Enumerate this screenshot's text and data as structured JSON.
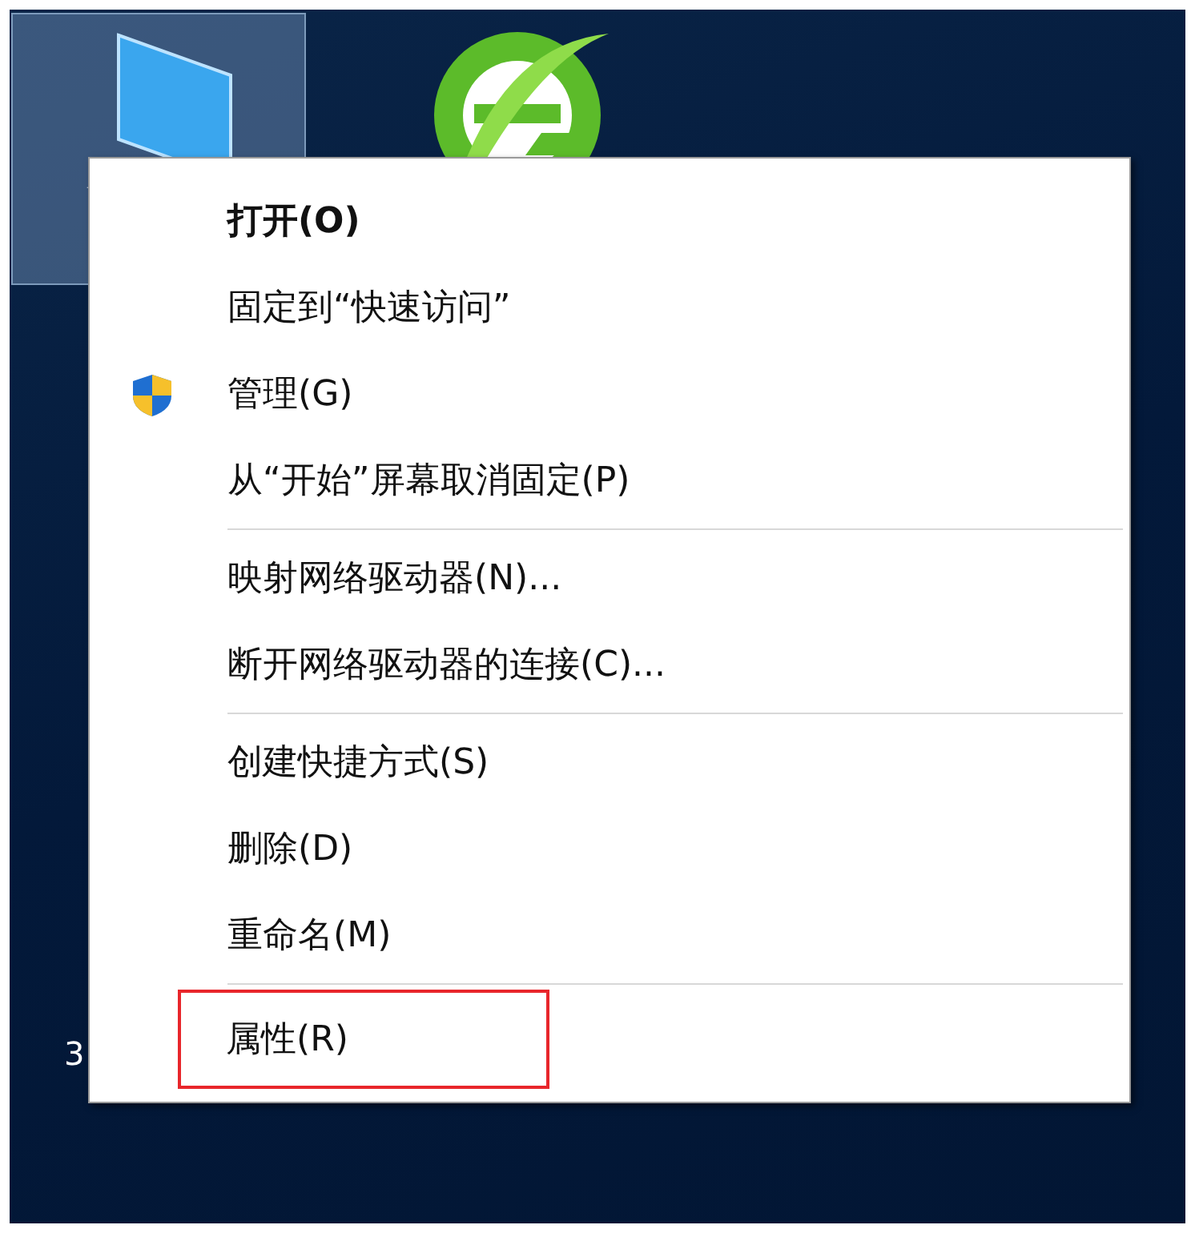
{
  "desktop": {
    "icons": [
      {
        "kind": "computer",
        "selected": true
      },
      {
        "kind": "browser",
        "selected": false
      }
    ],
    "partial_label": "3"
  },
  "context_menu": {
    "groups": [
      {
        "items": [
          {
            "label": "打开(O)",
            "default": true,
            "shield": false,
            "highlighted": false
          },
          {
            "label": "固定到“快速访问”",
            "default": false,
            "shield": false,
            "highlighted": false
          },
          {
            "label": "管理(G)",
            "default": false,
            "shield": true,
            "highlighted": false
          },
          {
            "label": "从“开始”屏幕取消固定(P)",
            "default": false,
            "shield": false,
            "highlighted": false
          }
        ]
      },
      {
        "items": [
          {
            "label": "映射网络驱动器(N)...",
            "default": false,
            "shield": false,
            "highlighted": false
          },
          {
            "label": "断开网络驱动器的连接(C)...",
            "default": false,
            "shield": false,
            "highlighted": false
          }
        ]
      },
      {
        "items": [
          {
            "label": "创建快捷方式(S)",
            "default": false,
            "shield": false,
            "highlighted": false
          },
          {
            "label": "删除(D)",
            "default": false,
            "shield": false,
            "highlighted": false
          },
          {
            "label": "重命名(M)",
            "default": false,
            "shield": false,
            "highlighted": false
          }
        ]
      },
      {
        "items": [
          {
            "label": "属性(R)",
            "default": false,
            "shield": false,
            "highlighted": true
          }
        ]
      }
    ]
  }
}
